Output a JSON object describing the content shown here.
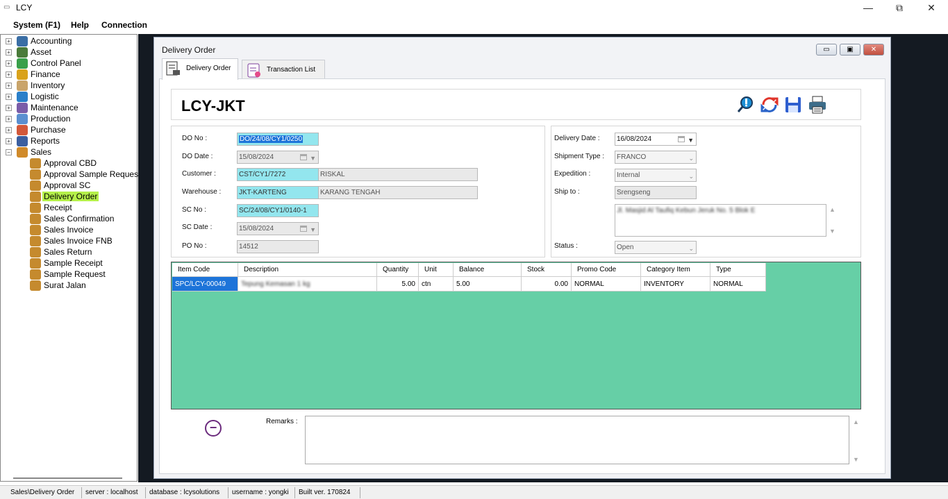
{
  "app": {
    "title": "LCY",
    "icon": "app-icon"
  },
  "window_controls": {
    "minimize": "—",
    "maximize": "⧉",
    "close": "✕"
  },
  "menu": [
    "System (F1)",
    "Help",
    "Connection"
  ],
  "tree": {
    "top": [
      {
        "label": "Accounting",
        "icon": "accounting-icon",
        "color": "#3a6ea5"
      },
      {
        "label": "Asset",
        "icon": "asset-icon",
        "color": "#4a7b3a"
      },
      {
        "label": "Control Panel",
        "icon": "control-panel-icon",
        "color": "#3aa04a"
      },
      {
        "label": "Finance",
        "icon": "finance-icon",
        "color": "#d9a21b"
      },
      {
        "label": "Inventory",
        "icon": "inventory-icon",
        "color": "#c9a46a"
      },
      {
        "label": "Logistic",
        "icon": "logistic-icon",
        "color": "#2a7fc9"
      },
      {
        "label": "Maintenance",
        "icon": "maintenance-icon",
        "color": "#7a5ca8"
      },
      {
        "label": "Production",
        "icon": "production-icon",
        "color": "#5a8fd0"
      },
      {
        "label": "Purchase",
        "icon": "purchase-icon",
        "color": "#d2583a"
      },
      {
        "label": "Reports",
        "icon": "reports-icon",
        "color": "#3b5fa0"
      },
      {
        "label": "Sales",
        "icon": "sales-icon",
        "color": "#d08a2a"
      }
    ],
    "sales_children": [
      "Approval CBD",
      "Approval Sample Reques",
      "Approval SC",
      "Delivery Order",
      "Receipt",
      "Sales Confirmation",
      "Sales Invoice",
      "Sales Invoice FNB",
      "Sales Return",
      "Sample Receipt",
      "Sample Request",
      "Surat Jalan"
    ],
    "selected": "Delivery Order",
    "selected_color": "#b5f04a"
  },
  "child": {
    "title": "Delivery Order",
    "min": "▭",
    "restore": "▣",
    "close": "✕"
  },
  "tabs": [
    {
      "label": "Delivery Order",
      "icon": "delivery-order-icon"
    },
    {
      "label": "Transaction List",
      "icon": "transaction-list-icon"
    }
  ],
  "company": "LCY-JKT",
  "toolbar_icons": [
    "search-icon",
    "refresh-icon",
    "save-icon",
    "print-icon"
  ],
  "form_left": {
    "do_no": {
      "label": "DO No :",
      "value": "DO/24/08/CY1/0250"
    },
    "do_date": {
      "label": "DO Date :",
      "value": "15/08/2024"
    },
    "customer": {
      "label": "Customer :",
      "code": "CST/CY1/7272",
      "name": "RISKAL"
    },
    "warehouse": {
      "label": "Warehouse :",
      "code": "JKT-KARTENG",
      "name": "KARANG TENGAH"
    },
    "sc_no": {
      "label": "SC No :",
      "value": "SC/24/08/CY1/0140-1"
    },
    "sc_date": {
      "label": "SC Date :",
      "value": "15/08/2024"
    },
    "po_no": {
      "label": "PO No :",
      "value": "14512"
    }
  },
  "form_right": {
    "delivery_date": {
      "label": "Delivery Date :",
      "value": "16/08/2024"
    },
    "shipment_type": {
      "label": "Shipment Type :",
      "value": "FRANCO"
    },
    "expedition": {
      "label": "Expedition :",
      "value": "Internal"
    },
    "ship_to": {
      "label": "Ship to :",
      "value": "Srengseng"
    },
    "address": "Jl. Masjid Al Taufiq Kebun Jeruk No. 5 Blok E",
    "status": {
      "label": "Status :",
      "value": "Open"
    }
  },
  "grid": {
    "headers": [
      "Item Code",
      "Description",
      "Quantity",
      "Unit",
      "Balance",
      "Stock",
      "Promo Code",
      "Category Item",
      "Type"
    ],
    "rows": [
      [
        "SPC/LCY-00049",
        "Tepung Kemasan 1 kg",
        "5.00",
        "ctn",
        "5.00",
        "0.00",
        "NORMAL",
        "INVENTORY",
        "NORMAL"
      ]
    ]
  },
  "remarks": {
    "label": "Remarks :",
    "value": ""
  },
  "status_bar": [
    "Sales\\Delivery Order",
    "server : localhost",
    "database : lcysolutions",
    "username : yongki",
    "Built ver. 170824"
  ]
}
